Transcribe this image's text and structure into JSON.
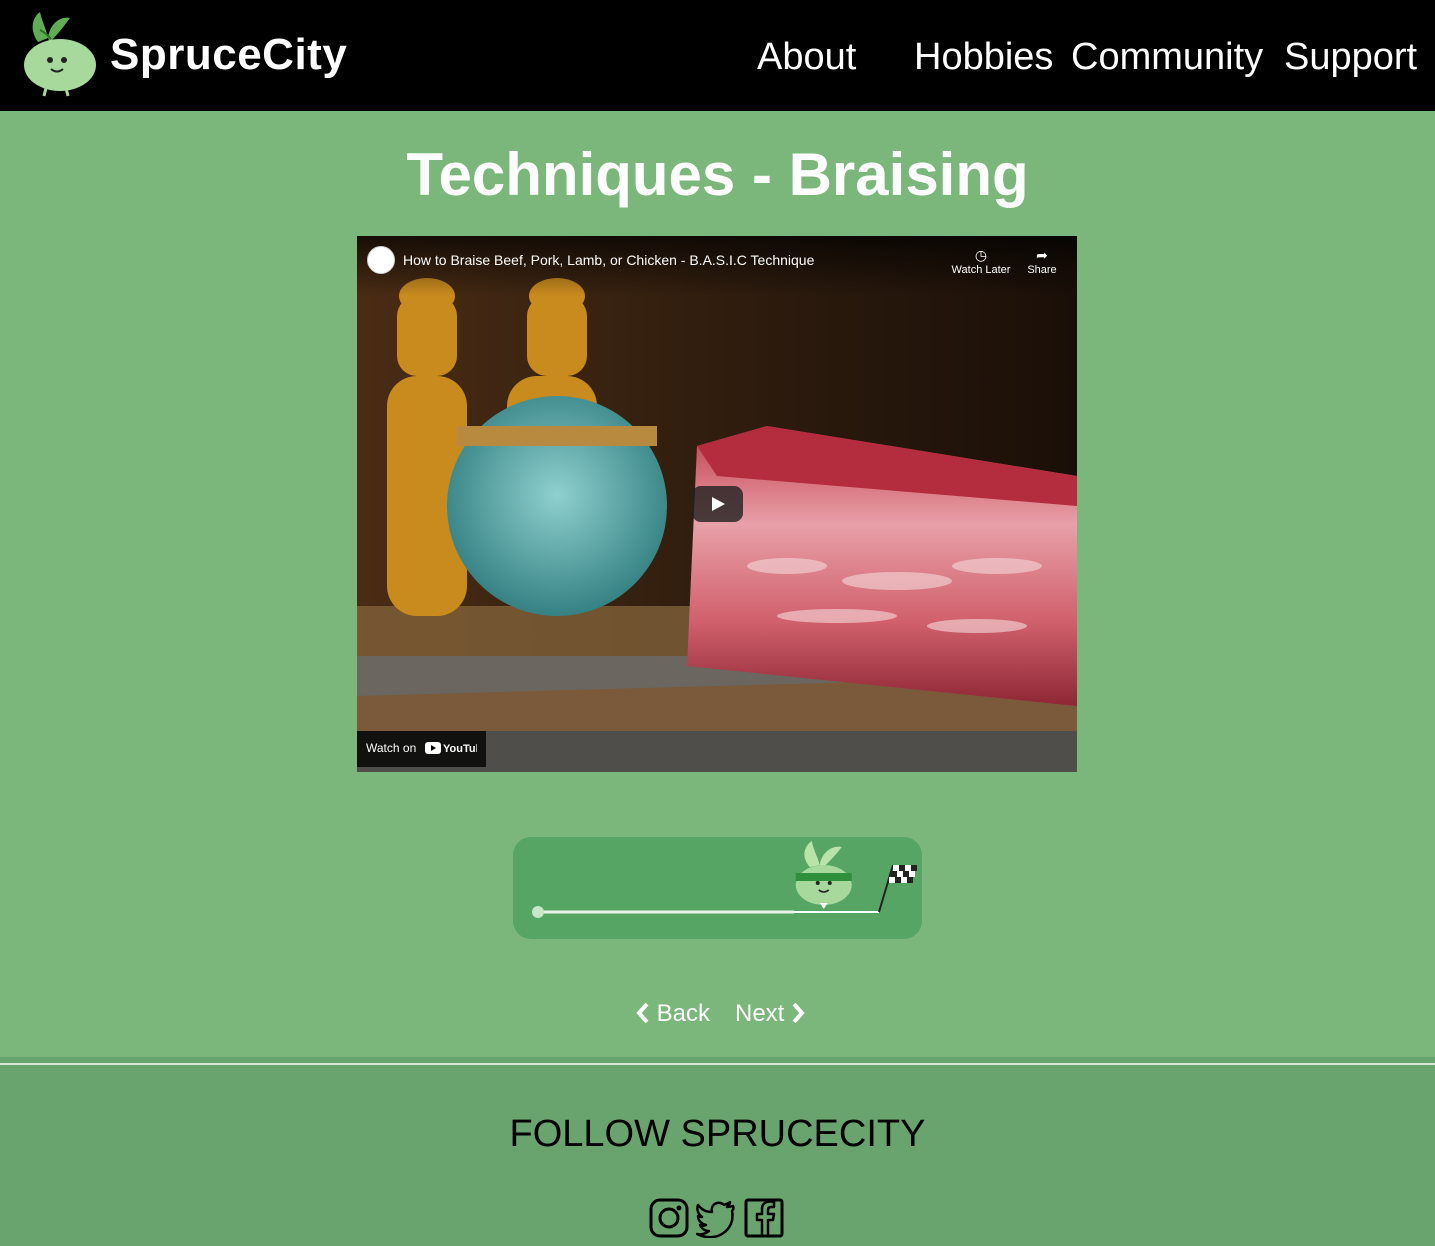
{
  "header": {
    "brand": "SpruceCity",
    "nav": [
      {
        "label": "About"
      },
      {
        "label": "Hobbies"
      },
      {
        "label": "Community"
      },
      {
        "label": "Support"
      }
    ]
  },
  "page": {
    "title": "Techniques - Braising"
  },
  "video": {
    "title": "How to Braise Beef, Pork, Lamb, or Chicken - B.A.S.I.C Technique",
    "watch_later_label": "Watch Later",
    "share_label": "Share",
    "watch_on_label": "Watch on",
    "youtube_label": "YouTube"
  },
  "progress": {
    "fraction_complete": 0.75
  },
  "pager": {
    "back_label": "Back",
    "next_label": "Next"
  },
  "footer": {
    "heading": "FOLLOW SPRUCECITY",
    "social": [
      "instagram-icon",
      "twitter-icon",
      "facebook-icon"
    ]
  },
  "colors": {
    "page_bg": "#7bb77b",
    "header_bg": "#000000",
    "footer_bg": "#69a46e",
    "progress_card": "#57a565",
    "mascot": "#a6d99b"
  }
}
